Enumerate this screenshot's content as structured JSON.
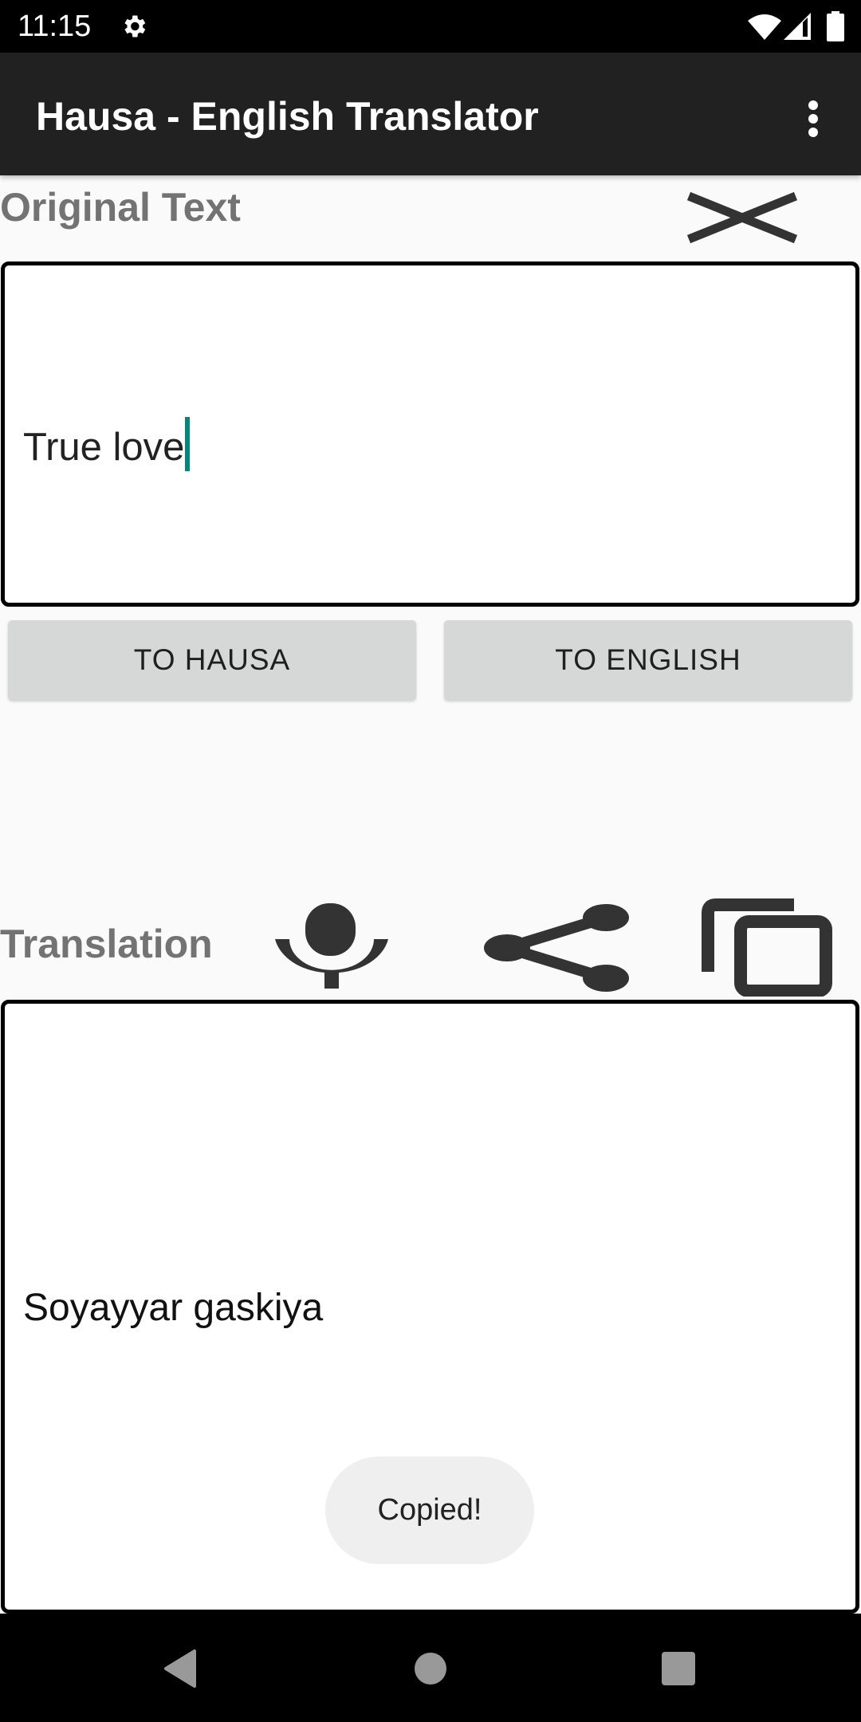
{
  "status_bar": {
    "time": "11:15",
    "icons": [
      "settings-gear-icon",
      "wifi-icon",
      "cell-signal-icon",
      "battery-icon"
    ]
  },
  "app_bar": {
    "title": "Hausa - English Translator",
    "overflow_icon": "more-vert-icon"
  },
  "original": {
    "label": "Original Text",
    "clear_icon": "close-icon",
    "input_value": "True love",
    "caret_color": "#00897b"
  },
  "actions": {
    "to_hausa": "TO HAUSA",
    "to_english": "TO ENGLISH"
  },
  "translation": {
    "label": "Translation",
    "icons": [
      "microphone-icon",
      "share-icon",
      "copy-icon"
    ],
    "output_value": "Soyayyar gaskiya"
  },
  "toast": {
    "message": "Copied!"
  },
  "nav_bar": {
    "buttons": [
      "back",
      "home",
      "recents"
    ]
  },
  "colors": {
    "app_bar": "#212121",
    "label_gray": "#737373",
    "button_bg": "#d6d7d7",
    "icon_dark": "#333333"
  }
}
